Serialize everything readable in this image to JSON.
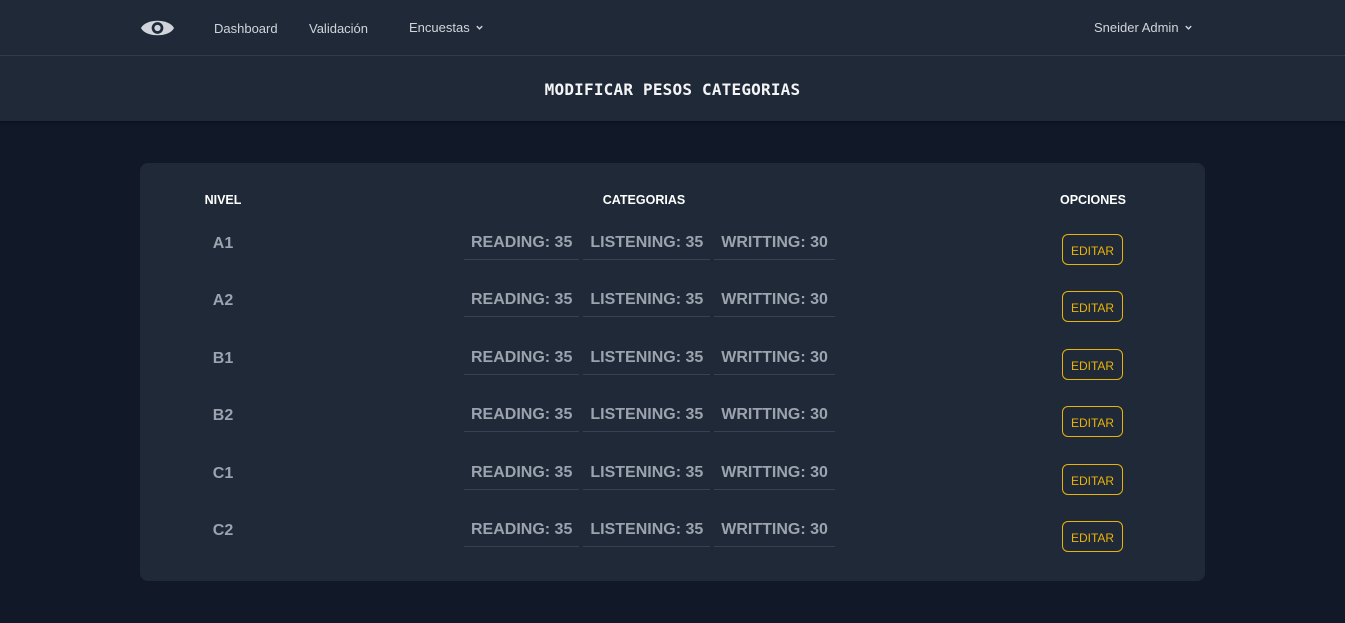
{
  "nav": {
    "links": [
      "Dashboard",
      "Validación"
    ],
    "dropdown_label": "Encuestas",
    "user_label": "Sneider Admin"
  },
  "header": {
    "title": "MODIFICAR PESOS CATEGORIAS"
  },
  "table": {
    "headers": [
      "NIVEL",
      "CATEGORIAS",
      "OPCIONES"
    ],
    "rows": [
      {
        "level": "A1",
        "categories": [
          "READING: 35",
          "LISTENING: 35",
          "WRITTING: 30"
        ],
        "action": "EDITAR"
      },
      {
        "level": "A2",
        "categories": [
          "READING: 35",
          "LISTENING: 35",
          "WRITTING: 30"
        ],
        "action": "EDITAR"
      },
      {
        "level": "B1",
        "categories": [
          "READING: 35",
          "LISTENING: 35",
          "WRITTING: 30"
        ],
        "action": "EDITAR"
      },
      {
        "level": "B2",
        "categories": [
          "READING: 35",
          "LISTENING: 35",
          "WRITTING: 30"
        ],
        "action": "EDITAR"
      },
      {
        "level": "C1",
        "categories": [
          "READING: 35",
          "LISTENING: 35",
          "WRITTING: 30"
        ],
        "action": "EDITAR"
      },
      {
        "level": "C2",
        "categories": [
          "READING: 35",
          "LISTENING: 35",
          "WRITTING: 30"
        ],
        "action": "EDITAR"
      }
    ]
  },
  "icons": {
    "logo": "eye-icon",
    "dropdown": "chevron-down-icon"
  },
  "colors": {
    "background": "#111827",
    "surface": "#1f2937",
    "accent": "#eab308",
    "muted_text": "#9ca3af"
  }
}
